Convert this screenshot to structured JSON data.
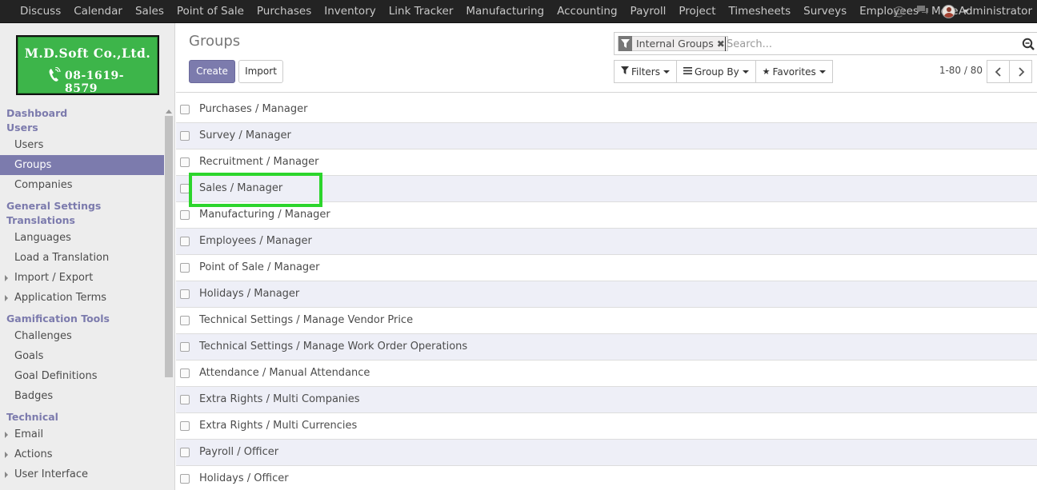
{
  "topbar": {
    "menus": [
      "Discuss",
      "Calendar",
      "Sales",
      "Point of Sale",
      "Purchases",
      "Inventory",
      "Link Tracker",
      "Manufacturing",
      "Accounting",
      "Payroll",
      "Project",
      "Timesheets",
      "Surveys",
      "Employees"
    ],
    "more_label": "More",
    "user": "Administrator",
    "icons": [
      "at-icon",
      "chat-icon",
      "avatar"
    ]
  },
  "logo": {
    "line1": "M.D.Soft Co.,Ltd.",
    "line2": "08-1619-8579"
  },
  "sidebar": {
    "sections": [
      {
        "heading": "Dashboard",
        "items": []
      },
      {
        "heading": "Users",
        "items": [
          {
            "label": "Users",
            "active": false,
            "expandable": false
          },
          {
            "label": "Groups",
            "active": true,
            "expandable": false
          },
          {
            "label": "Companies",
            "active": false,
            "expandable": false
          }
        ]
      },
      {
        "heading": "General Settings",
        "items": []
      },
      {
        "heading": "Translations",
        "items": [
          {
            "label": "Languages",
            "active": false,
            "expandable": false
          },
          {
            "label": "Load a Translation",
            "active": false,
            "expandable": false
          },
          {
            "label": "Import / Export",
            "active": false,
            "expandable": true
          },
          {
            "label": "Application Terms",
            "active": false,
            "expandable": true
          }
        ]
      },
      {
        "heading": "Gamification Tools",
        "items": [
          {
            "label": "Challenges",
            "active": false,
            "expandable": false
          },
          {
            "label": "Goals",
            "active": false,
            "expandable": false
          },
          {
            "label": "Goal Definitions",
            "active": false,
            "expandable": false
          },
          {
            "label": "Badges",
            "active": false,
            "expandable": false
          }
        ]
      },
      {
        "heading": "Technical",
        "items": [
          {
            "label": "Email",
            "active": false,
            "expandable": true
          },
          {
            "label": "Actions",
            "active": false,
            "expandable": true
          },
          {
            "label": "User Interface",
            "active": false,
            "expandable": true
          }
        ]
      }
    ]
  },
  "control_panel": {
    "title": "Groups",
    "create_label": "Create",
    "import_label": "Import",
    "facet_label": "Internal Groups",
    "search_placeholder": "Search...",
    "filters_label": "Filters",
    "groupby_label": "Group By",
    "favorites_label": "Favorites",
    "pager": "1-80 / 80"
  },
  "list": {
    "rows": [
      "Purchases / Manager",
      "Survey / Manager",
      "Recruitment / Manager",
      "Sales / Manager",
      "Manufacturing / Manager",
      "Employees / Manager",
      "Point of Sale / Manager",
      "Holidays / Manager",
      "Technical Settings / Manage Vendor Price",
      "Technical Settings / Manage Work Order Operations",
      "Attendance / Manual Attendance",
      "Extra Rights / Multi Companies",
      "Extra Rights / Multi Currencies",
      "Payroll / Officer",
      "Holidays / Officer"
    ],
    "highlighted_row": "Sales / Manager",
    "highlight_color": "#2cd52c"
  },
  "colors": {
    "brand": "#7c7bad",
    "topbar": "#232323",
    "logo_green": "#3db54a"
  }
}
